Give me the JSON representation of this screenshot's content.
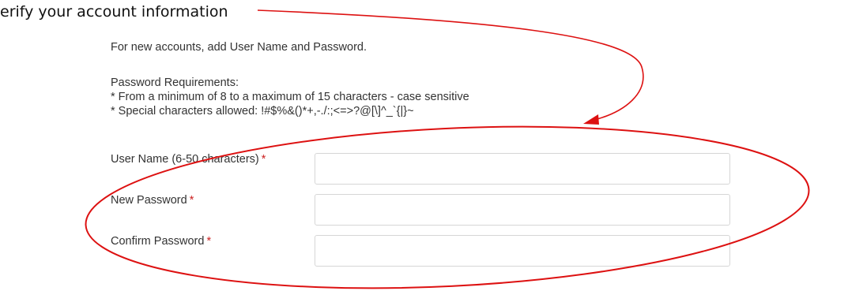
{
  "heading": "erify your account information",
  "instructions": {
    "intro": "For new accounts, add User Name and Password.",
    "requirements_title": "Password Requirements:",
    "requirement_1": "* From a minimum of 8 to a maximum of 15 characters - case sensitive",
    "requirement_2": "* Special characters allowed: !#$%&()*+,-./:;<=>?@[\\]^_`{|}~"
  },
  "form": {
    "username": {
      "label": "User Name (6-50 characters)",
      "required_mark": "*",
      "value": ""
    },
    "new_password": {
      "label": "New Password",
      "required_mark": "*",
      "value": ""
    },
    "confirm_password": {
      "label": "Confirm Password",
      "required_mark": "*",
      "value": ""
    }
  },
  "colors": {
    "annotation": "#dd1111",
    "required": "#cc2222",
    "text": "#333333"
  }
}
